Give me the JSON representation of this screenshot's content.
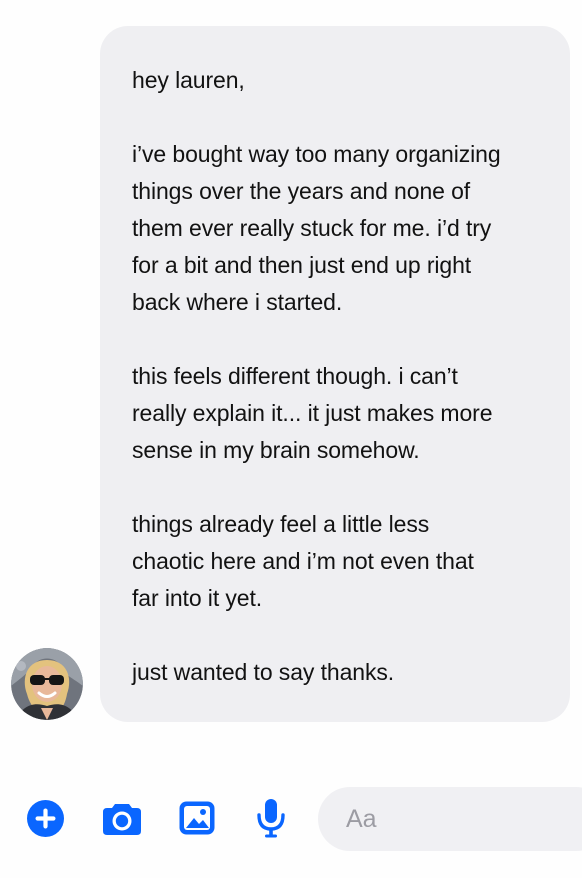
{
  "message": {
    "lines": [
      "hey lauren,",
      "",
      "i’ve bought way too many organizing",
      "things over the years and none of",
      "them ever really stuck for me. i’d try",
      "for a bit and then just end up right",
      "back where i started.",
      "",
      "this feels different though. i can’t",
      "really explain it... it just makes more",
      "sense in my brain somehow.",
      "",
      "things already feel a little less",
      "chaotic here and i’m not even that",
      "far into it yet.",
      "",
      "just wanted to say thanks."
    ]
  },
  "sender": {
    "avatar_icon": "avatar-photo"
  },
  "composer": {
    "plus_icon": "plus-circle-icon",
    "camera_icon": "camera-icon",
    "image_icon": "image-icon",
    "mic_icon": "microphone-icon",
    "input_placeholder": "Aa"
  },
  "colors": {
    "accent": "#0a66ff",
    "bubble": "#efeff2",
    "text": "#121212",
    "placeholder": "#9c9ca3"
  }
}
